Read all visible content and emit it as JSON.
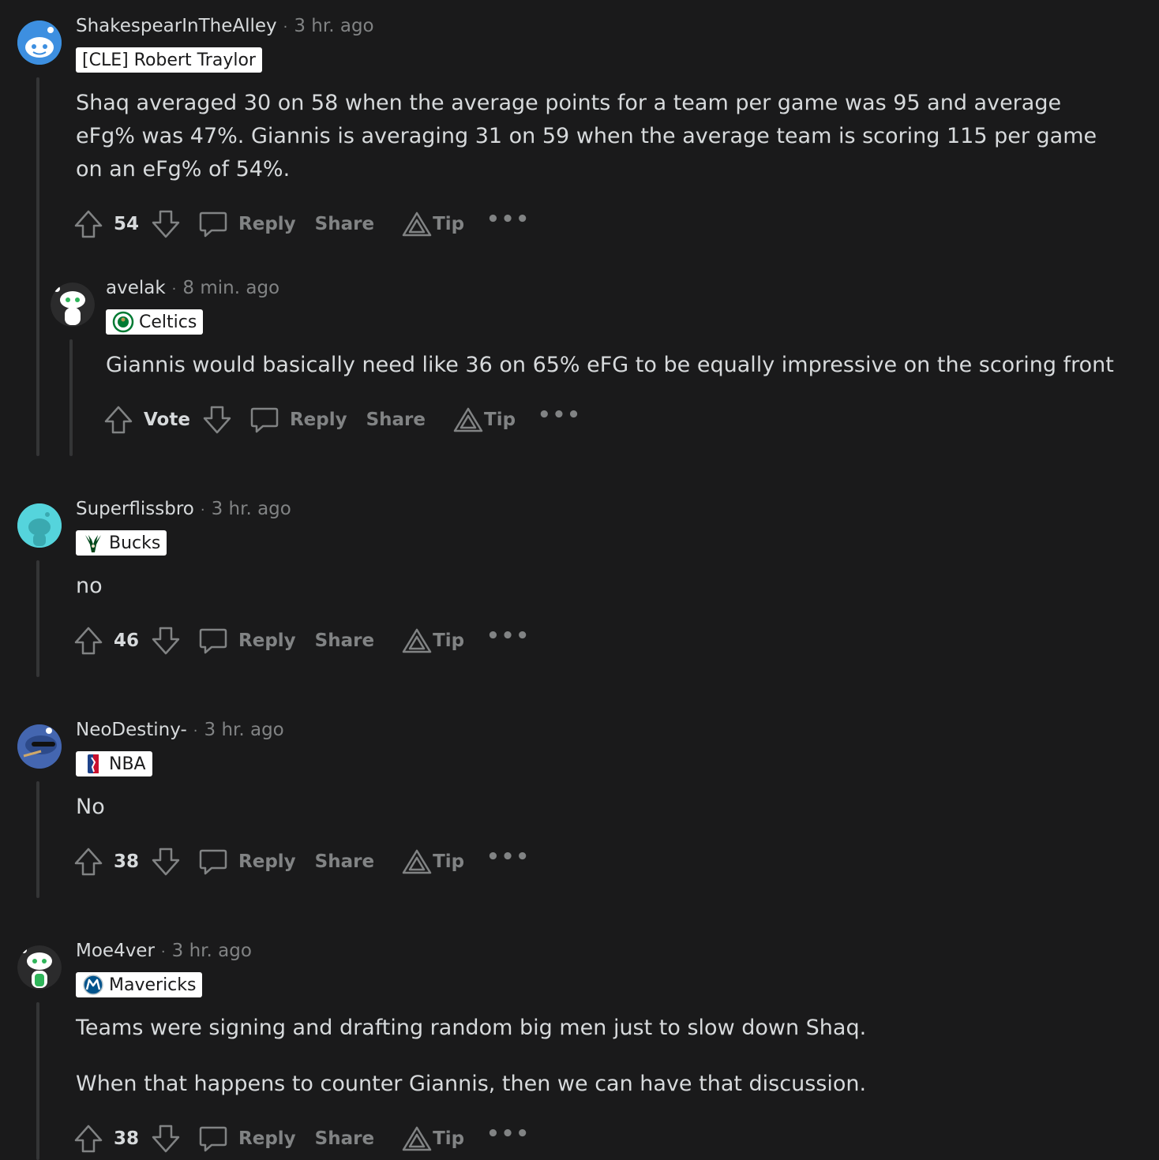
{
  "colors": {
    "background": "#1a1a1b",
    "text": "#d7dadc",
    "muted": "#818384",
    "thread_line": "#343536",
    "flair_bg": "#ffffff"
  },
  "actions": {
    "reply": "Reply",
    "share": "Share",
    "tip": "Tip",
    "more": "•••",
    "vote": "Vote"
  },
  "comments": [
    {
      "username": "ShakespearInTheAlley",
      "time": "3 hr. ago",
      "flair": "[CLE] Robert Traylor",
      "flair_icon": "none",
      "avatar": "snoo-blue-avatar",
      "body": [
        "Shaq averaged 30 on 58 when the average points for a team per game was 95 and average eFg% was 47%. Giannis is averaging 31 on 59 when the average team is scoring 115 per game on an eFg% of 54%."
      ],
      "score": "54"
    },
    {
      "username": "avelak",
      "time": "8 min. ago",
      "flair": "Celtics",
      "flair_icon": "celtics-logo-icon",
      "avatar": "snoo-white-avatar",
      "body": [
        "Giannis would basically need like 36 on 65% eFG to be equally impressive on the scoring front"
      ],
      "score": "Vote"
    },
    {
      "username": "Superflissbro",
      "time": "3 hr. ago",
      "flair": "Bucks",
      "flair_icon": "bucks-logo-icon",
      "avatar": "snoo-cyan-avatar",
      "body": [
        "no"
      ],
      "score": "46"
    },
    {
      "username": "NeoDestiny-",
      "time": "3 hr. ago",
      "flair": "NBA",
      "flair_icon": "nba-logo-icon",
      "avatar": "snoo-blue-dark-avatar",
      "body": [
        "No"
      ],
      "score": "38"
    },
    {
      "username": "Moe4ver",
      "time": "3 hr. ago",
      "flair": "Mavericks",
      "flair_icon": "mavericks-logo-icon",
      "avatar": "snoo-white-green-avatar",
      "body": [
        "Teams were signing and drafting random big men just to slow down Shaq.",
        "When that happens to counter Giannis, then we can have that discussion."
      ],
      "score": "38"
    }
  ]
}
